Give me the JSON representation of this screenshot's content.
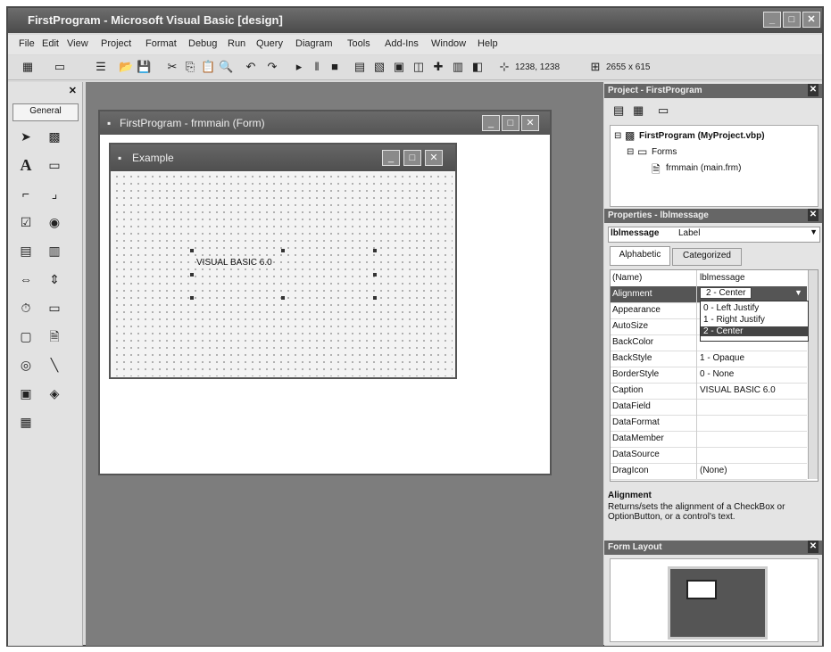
{
  "window": {
    "title": "FirstProgram - Microsoft Visual Basic [design]"
  },
  "menu": [
    "File",
    "Edit",
    "View",
    "Project",
    "Format",
    "Debug",
    "Run",
    "Query",
    "Diagram",
    "Tools",
    "Add-Ins",
    "Window",
    "Help"
  ],
  "toolbar": {
    "position_readout": "1238, 1238",
    "size_readout": "2655 x 615"
  },
  "toolbox": {
    "tab_label": "General"
  },
  "form_window": {
    "title": "FirstProgram - frmmain (Form)"
  },
  "form": {
    "caption": "Example",
    "label_text": "VISUAL BASIC 6.0"
  },
  "project_panel": {
    "title": "Project - FirstProgram",
    "root": "FirstProgram (MyProject.vbp)",
    "folder": "Forms",
    "file": "frmmain (main.frm)"
  },
  "properties_panel": {
    "title": "Properties - lblmessage",
    "object_name": "lblmessage",
    "object_type": "Label",
    "tabs": [
      "Alphabetic",
      "Categorized"
    ],
    "rows": [
      {
        "name": "(Name)",
        "value": "lblmessage"
      },
      {
        "name": "Alignment",
        "value": "2 - Center"
      },
      {
        "name": "Appearance",
        "value": ""
      },
      {
        "name": "AutoSize",
        "value": ""
      },
      {
        "name": "BackColor",
        "value": ""
      },
      {
        "name": "BackStyle",
        "value": "1 - Opaque"
      },
      {
        "name": "BorderStyle",
        "value": "0 - None"
      },
      {
        "name": "Caption",
        "value": "VISUAL BASIC 6.0"
      },
      {
        "name": "DataField",
        "value": ""
      },
      {
        "name": "DataFormat",
        "value": ""
      },
      {
        "name": "DataMember",
        "value": ""
      },
      {
        "name": "DataSource",
        "value": ""
      },
      {
        "name": "DragIcon",
        "value": "(None)"
      }
    ],
    "dropdown_options": [
      "0 - Left Justify",
      "1 - Right Justify",
      "2 - Center"
    ],
    "description_title": "Alignment",
    "description_text": "Returns/sets the alignment of a CheckBox or OptionButton, or a control's text."
  },
  "form_layout_panel": {
    "title": "Form Layout"
  }
}
